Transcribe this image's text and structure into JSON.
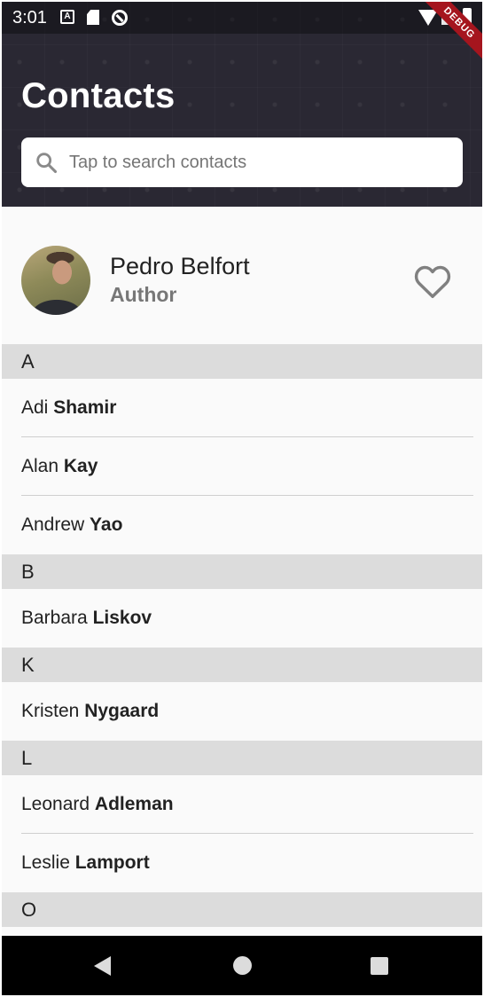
{
  "status_bar": {
    "time": "3:01",
    "notification_icons": [
      "font-a-icon",
      "sd-card-icon",
      "sync-icon"
    ],
    "system_icons": [
      "wifi-icon",
      "signal-icon",
      "battery-icon"
    ]
  },
  "debug_banner": "DEBUG",
  "header": {
    "title": "Contacts",
    "search_placeholder": "Tap to search contacts"
  },
  "profile": {
    "name": "Pedro Belfort",
    "role": "Author"
  },
  "sections": [
    {
      "letter": "A",
      "contacts": [
        {
          "first": "Adi",
          "last": "Shamir"
        },
        {
          "first": "Alan",
          "last": "Kay"
        },
        {
          "first": "Andrew",
          "last": "Yao"
        }
      ]
    },
    {
      "letter": "B",
      "contacts": [
        {
          "first": "Barbara",
          "last": "Liskov"
        }
      ]
    },
    {
      "letter": "K",
      "contacts": [
        {
          "first": "Kristen",
          "last": "Nygaard"
        }
      ]
    },
    {
      "letter": "L",
      "contacts": [
        {
          "first": "Leonard",
          "last": "Adleman"
        },
        {
          "first": "Leslie",
          "last": "Lamport"
        }
      ]
    },
    {
      "letter": "O",
      "contacts": []
    }
  ],
  "colors": {
    "header_bg": "#2a2833",
    "section_bg": "#dcdcdc",
    "list_bg": "#fafafa",
    "debug_ribbon": "#a5151e"
  }
}
